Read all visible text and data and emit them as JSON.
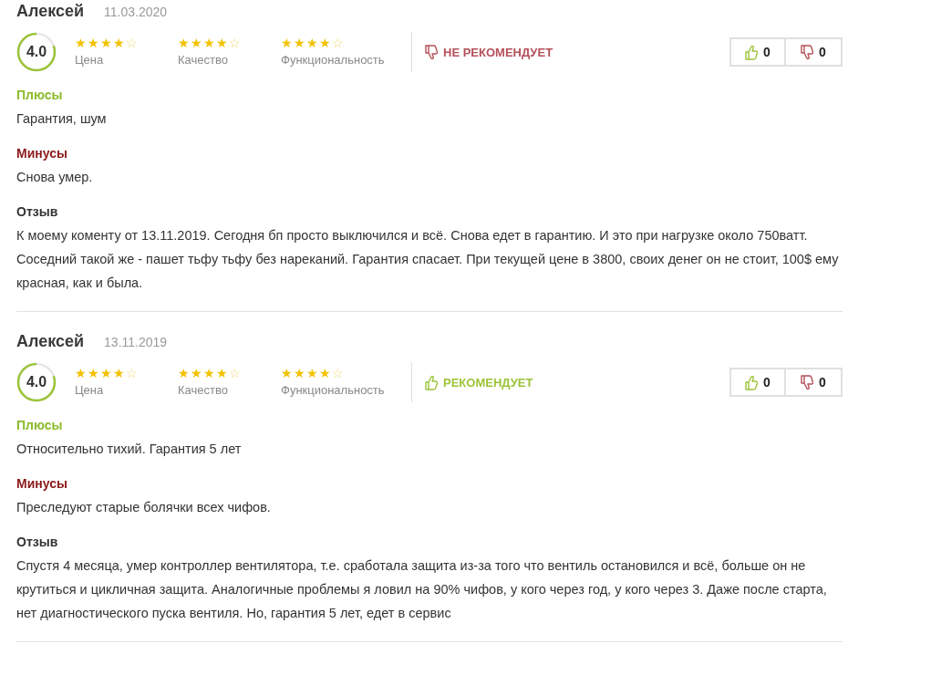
{
  "reviews": [
    {
      "author": "Алексей",
      "date": "11.03.2020",
      "score": "4.0",
      "criteria": [
        {
          "label": "Цена",
          "stars": 4
        },
        {
          "label": "Качество",
          "stars": 4
        },
        {
          "label": "Функциональность",
          "stars": 4
        }
      ],
      "recommends": false,
      "recommend_label": "НЕ РЕКОМЕНДУЕТ",
      "likes": "0",
      "dislikes": "0",
      "sections": [
        {
          "kind": "pros",
          "title": "Плюсы",
          "text": "Гарантия, шум"
        },
        {
          "kind": "cons",
          "title": "Минусы",
          "text": "Снова умер."
        },
        {
          "kind": "comment",
          "title": "Отзыв",
          "text": "К моему коменту от 13.11.2019. Сегодня бп просто выключился и всё. Снова едет в гарантию. И это при нагрузке около 750ватт. Соседний такой же - пашет тьфу тьфу без нареканий. Гарантия спасает. При текущей цене в 3800, своих денег он не стоит, 100$ ему красная, как и была."
        }
      ]
    },
    {
      "author": "Алексей",
      "date": "13.11.2019",
      "score": "4.0",
      "criteria": [
        {
          "label": "Цена",
          "stars": 4
        },
        {
          "label": "Качество",
          "stars": 4
        },
        {
          "label": "Функциональность",
          "stars": 4
        }
      ],
      "recommends": true,
      "recommend_label": "РЕКОМЕНДУЕТ",
      "likes": "0",
      "dislikes": "0",
      "sections": [
        {
          "kind": "pros",
          "title": "Плюсы",
          "text": "Относительно тихий. Гарантия 5 лет"
        },
        {
          "kind": "cons",
          "title": "Минусы",
          "text": "Преследуют старые болячки всех чифов."
        },
        {
          "kind": "comment",
          "title": "Отзыв",
          "text": "Спустя 4 месяца, умер контроллер вентилятора, т.е. сработала защита из-за того что вентиль остановился и всё, больше он не крутиться и цикличная защита. Аналогичные проблемы я ловил на 90% чифов, у кого через год, у кого через 3. Даже после старта, нет диагностического пуска вентиля. Но, гарантия 5 лет, едет в сервис"
        }
      ]
    }
  ]
}
